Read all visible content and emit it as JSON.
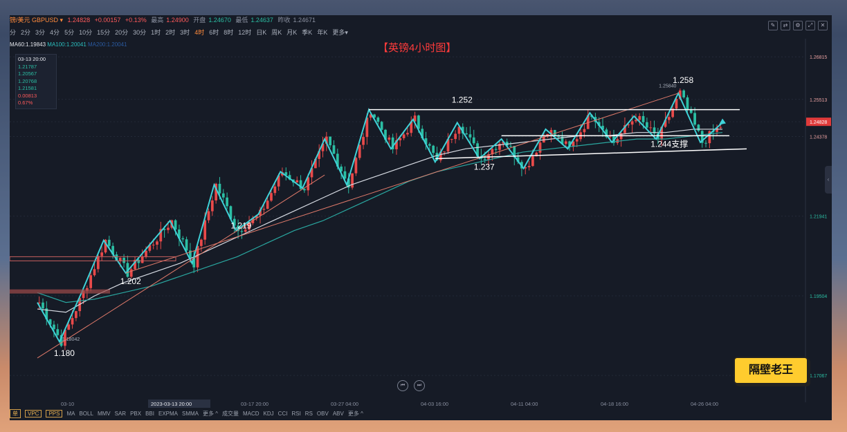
{
  "header": {
    "pair": "镑/美元 GBPUSD ▾",
    "price": "1.24828",
    "change": "+0.00157",
    "change_pct": "+0.13%",
    "high_label": "最高",
    "high": "1.24900",
    "open_label": "开盘",
    "open": "1.24670",
    "low_label": "最低",
    "low": "1.24637",
    "prev_label": "昨收",
    "prev": "1.24671"
  },
  "timeframes": [
    "分",
    "2分",
    "3分",
    "4分",
    "5分",
    "10分",
    "15分",
    "20分",
    "30分",
    "1时",
    "2时",
    "3时",
    "4时",
    "6时",
    "8时",
    "12时",
    "日K",
    "周K",
    "月K",
    "季K",
    "年K",
    "更多▾"
  ],
  "active_timeframe": "4时",
  "ma": {
    "ma60": "MA60:1.19843",
    "ma100": "MA100:1.20041",
    "ma200": "MA200:1.20041"
  },
  "ohlc_box": {
    "date": "03-13 20:00",
    "v1": "1.21787",
    "v2": "1.20567",
    "v3": "1.20768",
    "v4": "1.21581",
    "v5": "0.00813",
    "v6": "0.67%"
  },
  "bottom": {
    "tags": [
      "单",
      "VPC",
      "PPS"
    ],
    "indicators": [
      "MA",
      "BOLL",
      "MMV",
      "SAR",
      "PBX",
      "BBI",
      "EXPMA",
      "SMMA",
      "更多 ^",
      "成交量",
      "MACD",
      "KDJ",
      "CCI",
      "RSI",
      "RS",
      "OBV",
      "ABV",
      "更多 ^"
    ]
  },
  "logo": "隔壁老王",
  "chart_data": {
    "type": "candlestick",
    "title": "【英镑4小时图】",
    "x_ticks": [
      "03-10",
      "2023-03-13 20:00",
      "03-17 20:00",
      "03-27 04:00",
      "04-03 16:00",
      "04-11 04:00",
      "04-18 16:00",
      "04-26 04:00"
    ],
    "y_ticks": [
      "1.26815",
      "1.25513",
      "1.24828",
      "1.24378",
      "1.21941",
      "1.19504",
      "1.17067"
    ],
    "ylim": [
      1.165,
      1.272
    ],
    "current_price": 1.24828,
    "pivots": [
      {
        "label": "1.180",
        "value": 1.18
      },
      {
        "label": "1.202",
        "value": 1.202
      },
      {
        "label": "1.219",
        "value": 1.219
      },
      {
        "label": "1.237",
        "value": 1.237
      },
      {
        "label": "1.252",
        "value": 1.252
      },
      {
        "label": "1.244支撑",
        "value": 1.244
      },
      {
        "label": "1.258",
        "value": 1.258
      }
    ],
    "price_annotations": [
      "1.18042",
      "1.25840"
    ],
    "zigzag": [
      1.193,
      1.181,
      1.196,
      1.212,
      1.202,
      1.21,
      1.218,
      1.205,
      1.229,
      1.215,
      1.22,
      1.233,
      1.228,
      1.243,
      1.229,
      1.252,
      1.24,
      1.249,
      1.236,
      1.248,
      1.237,
      1.243,
      1.234,
      1.246,
      1.24,
      1.251,
      1.242,
      1.25,
      1.243,
      1.257,
      1.242,
      1.248
    ],
    "ma_a": [
      1.191,
      1.19,
      1.195,
      1.199,
      1.202,
      1.205,
      1.209,
      1.213,
      1.217,
      1.221,
      1.225,
      1.229,
      1.232,
      1.235,
      1.238,
      1.24,
      1.241,
      1.242,
      1.243,
      1.244,
      1.244,
      1.245,
      1.245,
      1.246,
      1.246
    ],
    "ma_b": [
      1.196,
      1.193,
      1.194,
      1.196,
      1.198,
      1.201,
      1.204,
      1.207,
      1.211,
      1.215,
      1.218,
      1.222,
      1.226,
      1.23,
      1.233,
      1.235,
      1.237,
      1.239,
      1.24,
      1.241,
      1.242,
      1.243,
      1.243,
      1.244,
      1.245
    ],
    "colors": {
      "up": "#e84a4a",
      "down": "#2bbfa4",
      "zigzag": "#3fd2d8",
      "ma_white": "#d8dce4",
      "ma_teal": "#2aa7a0",
      "trend": "#e07a6a",
      "title": "#ff3b3b",
      "bg": "#161b26",
      "hline": "#ffffff"
    }
  }
}
